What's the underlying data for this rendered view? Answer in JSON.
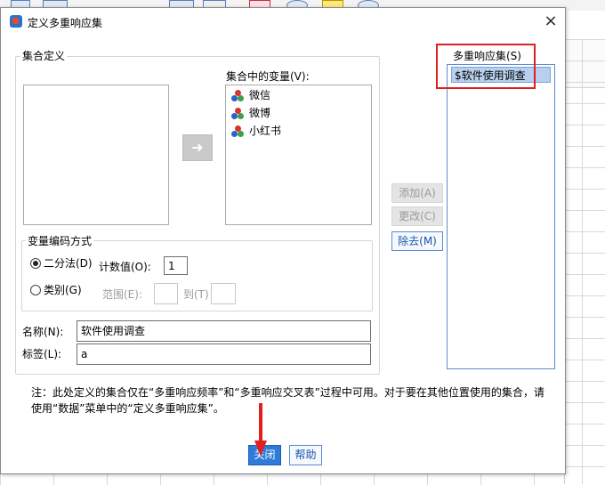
{
  "dialog": {
    "title": "定义多重响应集",
    "close_glyph": "×"
  },
  "set_definition": {
    "group_label": "集合定义",
    "variables_in_set_label": "集合中的变量(V):",
    "variables": [
      "微信",
      "微博",
      "小红书"
    ],
    "move_arrow_glyph": "➜"
  },
  "encoding": {
    "group_label": "变量编码方式",
    "dichotomy_label": "二分法(D)",
    "dichotomy_checked": true,
    "counted_value_label": "计数值(O):",
    "counted_value": "1",
    "category_label": "类别(G)",
    "range_label": "范围(E):",
    "to_label": "到(T)"
  },
  "name": {
    "label": "名称(N):",
    "value": "软件使用调查"
  },
  "label": {
    "label": "标签(L):",
    "value": "a"
  },
  "actions": {
    "add_label": "添加(A)",
    "change_label": "更改(C)",
    "remove_label": "除去(M)"
  },
  "multi_response_sets": {
    "label": "多重响应集(S)",
    "items": [
      "$软件使用调查"
    ]
  },
  "note": "注：此处定义的集合仅在“多重响应频率”和“多重响应交叉表”过程中可用。对于要在其他位置使用的集合，请使用“数据”菜单中的“定义多重响应集”。",
  "footer": {
    "close_label": "关闭",
    "help_label": "帮助"
  },
  "colors": {
    "highlight_red": "#e02020",
    "primary_blue": "#2f7bd8"
  }
}
